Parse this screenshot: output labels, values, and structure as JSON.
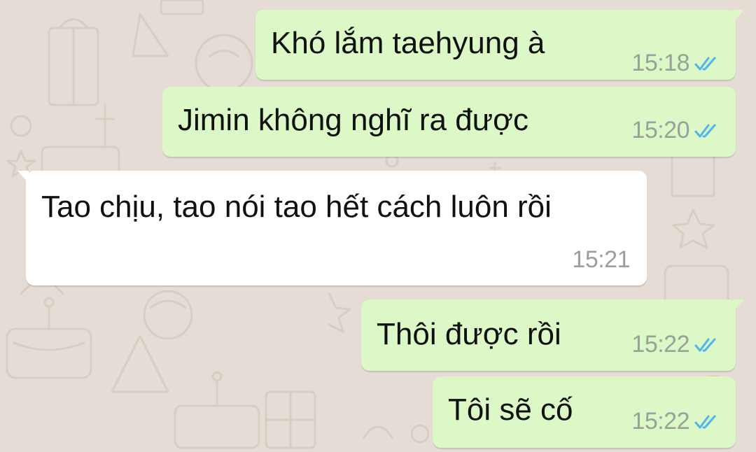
{
  "theme": {
    "wallpaper_color": "#e5ddd5",
    "outgoing_color": "#dcf8c6",
    "incoming_color": "#ffffff",
    "read_tick_color": "#4fb5ec"
  },
  "messages": [
    {
      "direction": "outgoing",
      "text": "Khó lắm taehyung à",
      "time": "15:18",
      "status_icon": "double-check-read-icon"
    },
    {
      "direction": "outgoing",
      "text": "Jimin không nghĩ ra được",
      "time": "15:20",
      "status_icon": "double-check-read-icon"
    },
    {
      "direction": "incoming",
      "text": "Tao chịu, tao nói tao hết cách luôn rồi",
      "time": "15:21"
    },
    {
      "direction": "outgoing",
      "text": "Thôi được rồi",
      "time": "15:22",
      "status_icon": "double-check-read-icon"
    },
    {
      "direction": "outgoing",
      "text": "Tôi sẽ cố",
      "time": "15:22",
      "status_icon": "double-check-read-icon"
    }
  ]
}
